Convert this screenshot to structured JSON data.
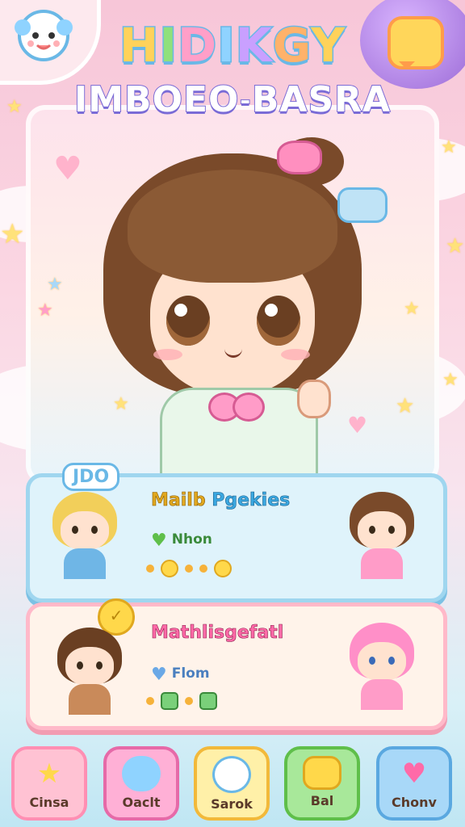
{
  "header": {
    "title_line1": "HIDIKGY",
    "title_line2": "IMBOEO˗BASRA"
  },
  "corner": {
    "badge_icon": "mascot-icon",
    "chat_icon": "chat-bubble-icon"
  },
  "cards": [
    {
      "tag": "JDO",
      "title_a": "Mailb ",
      "title_b": "Pgekies",
      "stat_label": "Nhon",
      "stat_icon": "heart-icon"
    },
    {
      "tag": "",
      "title_a": "Mathlisgefatl",
      "title_b": "",
      "stat_label": "Flom",
      "stat_icon": "heart-icon"
    }
  ],
  "nav": {
    "items": [
      {
        "label": "Cinsa",
        "icon": "star-icon"
      },
      {
        "label": "Oaclt",
        "icon": "pill-icon"
      },
      {
        "label": "Sarok",
        "icon": "mascot-icon"
      },
      {
        "label": "Bal",
        "icon": "chest-icon"
      },
      {
        "label": "Chonv",
        "icon": "heart-icon"
      }
    ]
  },
  "colors": {
    "accent_pink": "#ff8fbf",
    "accent_blue": "#6ab8e6",
    "accent_yellow": "#ffd84a",
    "accent_green": "#5fbf4a"
  }
}
